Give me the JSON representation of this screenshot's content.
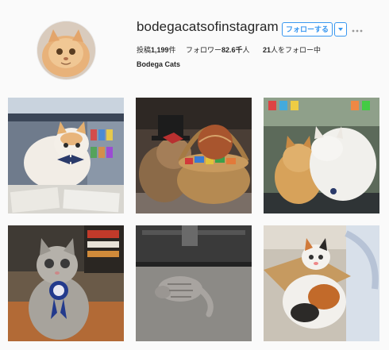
{
  "profile": {
    "username": "bodegacatsofinstagram",
    "follow_label": "フォローする",
    "stats": {
      "posts_label": "投稿",
      "posts_count": "1,199",
      "posts_unit": "件",
      "followers_label": "フォロワー",
      "followers_count": "82.6千",
      "followers_unit": "人",
      "following_count": "21",
      "following_label": "人をフォロー中"
    },
    "full_name": "Bodega Cats"
  },
  "colors": {
    "accent": "#3897f0",
    "text": "#262626",
    "background": "#fafafa"
  },
  "icons": {
    "dropdown": "chevron-down-icon",
    "more": "more-options-icon"
  },
  "posts": [
    {
      "id": "post-1"
    },
    {
      "id": "post-2"
    },
    {
      "id": "post-3"
    },
    {
      "id": "post-4"
    },
    {
      "id": "post-5"
    },
    {
      "id": "post-6"
    }
  ]
}
